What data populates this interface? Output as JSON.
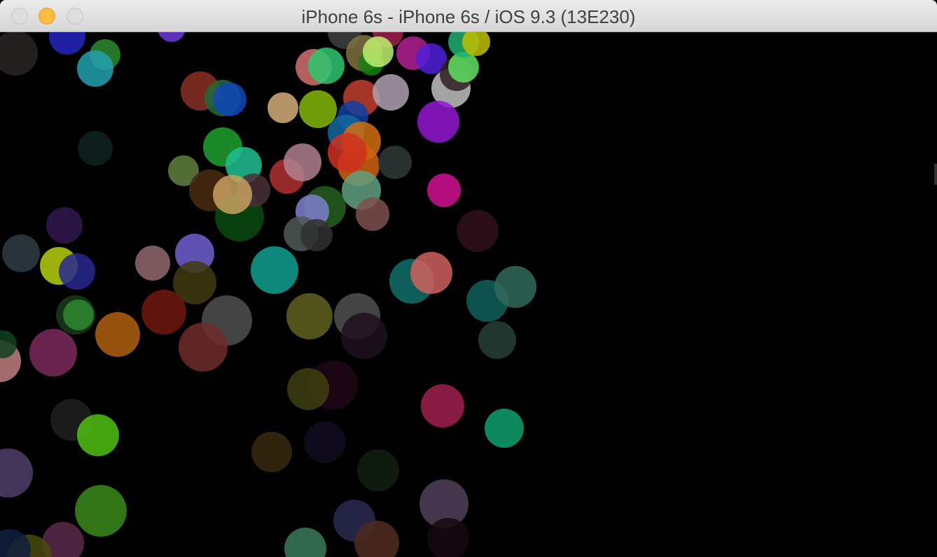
{
  "window": {
    "title": "iPhone 6s - iPhone 6s / iOS 9.3 (13E230)",
    "background_color": "#000000"
  },
  "controls": {
    "close": "close-icon",
    "minimize": "minimize-icon",
    "zoom": "zoom-icon"
  }
}
